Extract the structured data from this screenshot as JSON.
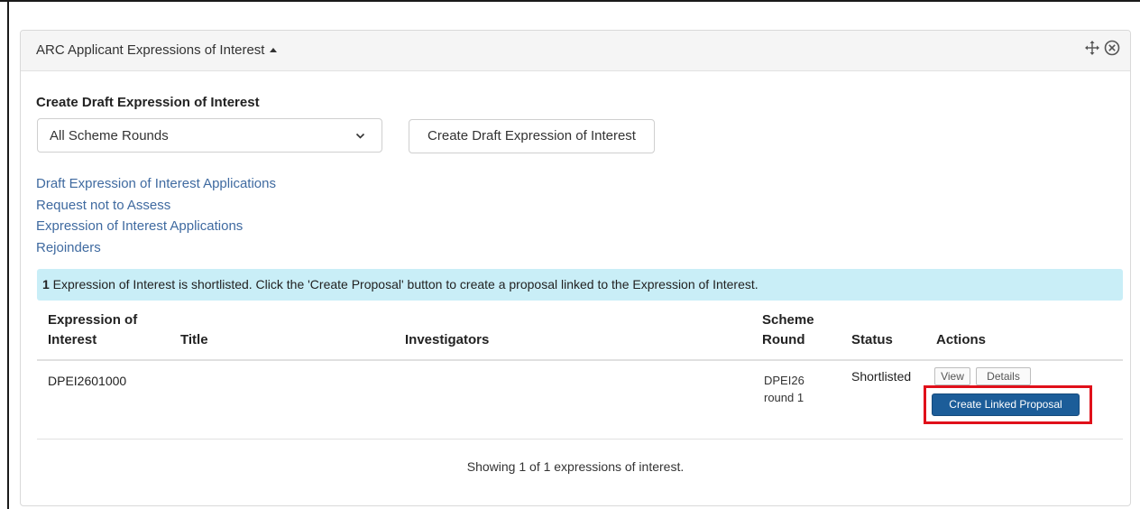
{
  "panel": {
    "title": "ARC Applicant Expressions of Interest",
    "icons": [
      "move-icon",
      "close-circle-icon"
    ]
  },
  "create": {
    "heading": "Create Draft Expression of Interest",
    "select_value": "All Scheme Rounds",
    "button_label": "Create Draft Expression of Interest"
  },
  "links": [
    "Draft Expression of Interest Applications",
    "Request not to Assess",
    "Expression of Interest Applications",
    "Rejoinders"
  ],
  "alert": {
    "count": "1",
    "text": " Expression of Interest is shortlisted. Click the 'Create Proposal' button to create a proposal linked to the Expression of Interest.",
    "color": "#c9eef7"
  },
  "table": {
    "headers": {
      "eoi_line1": "Expression of",
      "eoi_line2": "Interest",
      "title": "Title",
      "investigators": "Investigators",
      "scheme_line1": "Scheme",
      "scheme_line2": "Round",
      "status": "Status",
      "actions": "Actions"
    },
    "rows": [
      {
        "eoi": "DPEI2601000",
        "title": "",
        "investigators": "",
        "scheme_line1": "DPEI26",
        "scheme_line2": "round 1",
        "status": "Shortlisted",
        "view_label": "View",
        "details_label": "Details",
        "linked_label": "Create Linked Proposal"
      }
    ]
  },
  "footer": {
    "text": "Showing 1 of 1 expressions of interest."
  },
  "colors": {
    "link": "#3f6aa0",
    "primary_button": "#1c5d99",
    "highlight": "#e0101a"
  }
}
